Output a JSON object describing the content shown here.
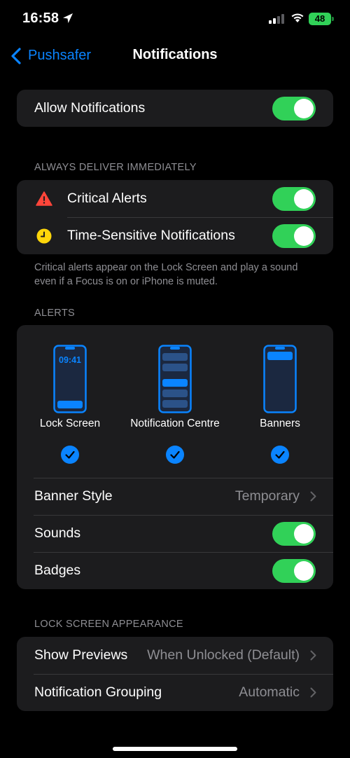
{
  "status_bar": {
    "time": "16:58",
    "battery": "48"
  },
  "nav": {
    "back_label": "Pushsafer",
    "title": "Notifications"
  },
  "allow": {
    "label": "Allow Notifications",
    "on": true
  },
  "always_deliver": {
    "header": "ALWAYS DELIVER IMMEDIATELY",
    "items": [
      {
        "label": "Critical Alerts",
        "icon": "warning-icon",
        "color": "#ff453a",
        "on": true
      },
      {
        "label": "Time-Sensitive Notifications",
        "icon": "clock-icon",
        "color": "#ffd60a",
        "on": true
      }
    ],
    "footer": "Critical alerts appear on the Lock Screen and play a sound even if a Focus is on or iPhone is muted."
  },
  "alerts": {
    "header": "ALERTS",
    "styles": [
      {
        "label": "Lock Screen",
        "preview_time": "09:41",
        "checked": true
      },
      {
        "label": "Notification Centre",
        "checked": true
      },
      {
        "label": "Banners",
        "checked": true
      }
    ],
    "banner_style": {
      "label": "Banner Style",
      "value": "Temporary"
    },
    "sounds": {
      "label": "Sounds",
      "on": true
    },
    "badges": {
      "label": "Badges",
      "on": true
    }
  },
  "lock_screen": {
    "header": "LOCK SCREEN APPEARANCE",
    "show_previews": {
      "label": "Show Previews",
      "value": "When Unlocked (Default)"
    },
    "grouping": {
      "label": "Notification Grouping",
      "value": "Automatic"
    }
  },
  "colors": {
    "accent": "#0a84ff",
    "toggle_on": "#31d158",
    "background": "#000000",
    "cell": "#1c1c1e"
  }
}
